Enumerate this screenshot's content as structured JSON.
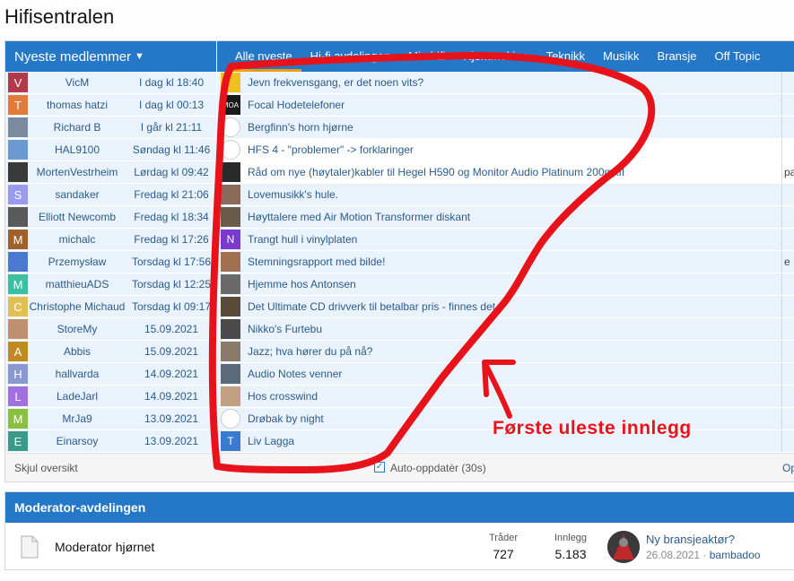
{
  "page": {
    "title": "Hifisentralen"
  },
  "members_header": {
    "label": "Nyeste medlemmer"
  },
  "tabs": [
    {
      "label": "Alle nyeste",
      "active": true
    },
    {
      "label": "Hi-fi avdelingen"
    },
    {
      "label": "Min hifi"
    },
    {
      "label": "Hjemmekino"
    },
    {
      "label": "Teknikk"
    },
    {
      "label": "Musikk"
    },
    {
      "label": "Bransje"
    },
    {
      "label": "Off Topic"
    }
  ],
  "members": [
    {
      "name": "VicM",
      "date": "I dag kl 18:40",
      "letter": "V",
      "color": "#b03a4a"
    },
    {
      "name": "thomas hatzi",
      "date": "I dag kl 00:13",
      "letter": "T",
      "color": "#e27a3a"
    },
    {
      "name": "Richard B",
      "date": "I går kl 21:11",
      "letter": "",
      "color": "#7a8aa0"
    },
    {
      "name": "HAL9100",
      "date": "Søndag kl 11:46",
      "letter": "",
      "color": "#6a9ad0"
    },
    {
      "name": "MortenVestrheim",
      "date": "Lørdag kl 09:42",
      "letter": "",
      "color": "#3a3a3a"
    },
    {
      "name": "sandaker",
      "date": "Fredag kl 21:06",
      "letter": "S",
      "color": "#9a9af0"
    },
    {
      "name": "Elliott Newcomb",
      "date": "Fredag kl 18:34",
      "letter": "",
      "color": "#5a5a5a"
    },
    {
      "name": "michalc",
      "date": "Fredag kl 17:26",
      "letter": "M",
      "color": "#a0602a"
    },
    {
      "name": "Przemysław",
      "date": "Torsdag kl 17:56",
      "letter": "",
      "color": "#4a7ad0"
    },
    {
      "name": "matthieuADS",
      "date": "Torsdag kl 12:25",
      "letter": "M",
      "color": "#3ac0a0"
    },
    {
      "name": "Christophe Michaud",
      "date": "Torsdag kl 09:17",
      "letter": "C",
      "color": "#e0c050"
    },
    {
      "name": "StoreMy",
      "date": "15.09.2021",
      "letter": "",
      "color": "#c09070"
    },
    {
      "name": "Abbis",
      "date": "15.09.2021",
      "letter": "A",
      "color": "#c08a20"
    },
    {
      "name": "hallvarda",
      "date": "14.09.2021",
      "letter": "H",
      "color": "#8a9ad0"
    },
    {
      "name": "LadeJarl",
      "date": "14.09.2021",
      "letter": "L",
      "color": "#a070e0"
    },
    {
      "name": "MrJa9",
      "date": "13.09.2021",
      "letter": "M",
      "color": "#8ac040"
    },
    {
      "name": "Einarsoy",
      "date": "13.09.2021",
      "letter": "E",
      "color": "#3a9a8a"
    }
  ],
  "threads": [
    {
      "title": "Jevn frekvensgang, er det noen vits?",
      "letter": "",
      "color": "#f0c020",
      "icon": "cartoon-avatar-icon"
    },
    {
      "title": "Focal Hodetelefoner",
      "letter": "MOA",
      "color": "#1a1a1a",
      "icon": "moa-logo-icon"
    },
    {
      "title": "Bergfinn's horn hjørne",
      "letter": "",
      "color": "#ffffff",
      "icon": "speaker-icon"
    },
    {
      "title": "HFS 4 - \"problemer\" -> forklaringer",
      "letter": "",
      "color": "#ffffff",
      "icon": "eye-icon",
      "read": true
    },
    {
      "title": "Råd om nye (høytaler)kabler til Hegel H590 og Monitor Audio Platinum 200mkII",
      "letter": "",
      "color": "#2a2a2a",
      "icon": "amplifier-icon",
      "read": true,
      "right": "pa"
    },
    {
      "title": "Lovemusikk's hule.",
      "letter": "",
      "color": "#8a6a5a",
      "icon": "photo-avatar-icon"
    },
    {
      "title": "Høyttalere med Air Motion Transformer diskant",
      "letter": "",
      "color": "#6a5a4a",
      "icon": "photo-avatar-icon"
    },
    {
      "title": "Trangt hull i vinylplaten",
      "letter": "N",
      "color": "#7a3ad0",
      "icon": "letter-avatar-icon"
    },
    {
      "title": "Stemningsrapport med bilde!",
      "letter": "",
      "color": "#a07050",
      "icon": "photo-avatar-icon",
      "right": "e"
    },
    {
      "title": "Hjemme hos Antonsen",
      "letter": "",
      "color": "#6a6a6a",
      "icon": "photo-avatar-icon"
    },
    {
      "title": "Det Ultimate CD drivverk til betalbar pris - finnes det ?",
      "letter": "",
      "color": "#5a4a3a",
      "icon": "photo-avatar-icon"
    },
    {
      "title": "Nikko's Furtebu",
      "letter": "",
      "color": "#4a4a4a",
      "icon": "photo-avatar-icon"
    },
    {
      "title": "Jazz; hva hører du på nå?",
      "letter": "",
      "color": "#8a7a6a",
      "icon": "photo-avatar-icon"
    },
    {
      "title": "Audio Notes venner",
      "letter": "",
      "color": "#5a6a7a",
      "icon": "photo-avatar-icon"
    },
    {
      "title": "Hos crosswind",
      "letter": "",
      "color": "#c0a080",
      "icon": "photo-avatar-icon"
    },
    {
      "title": "Drøbak by night",
      "letter": "",
      "color": "#ffffff",
      "icon": "figure-icon"
    },
    {
      "title": "Liv Lagga",
      "letter": "T",
      "color": "#3a7ad0",
      "icon": "letter-avatar-icon"
    }
  ],
  "footer": {
    "hide_label": "Skjul oversikt",
    "auto_update_label": "Auto-oppdatèr (30s)",
    "right_label": "Op"
  },
  "moderator": {
    "section_title": "Moderator-avdelingen",
    "node_title": "Moderator hjørnet",
    "threads_label": "Tråder",
    "threads_value": "727",
    "posts_label": "Innlegg",
    "posts_value": "5.183",
    "last_title": "Ny bransjeaktør?",
    "last_date": "26.08.2021",
    "last_separator": " · ",
    "last_user": "bambadoo"
  },
  "annotation": {
    "text": "Første uleste innlegg",
    "color": "#e8131a"
  }
}
